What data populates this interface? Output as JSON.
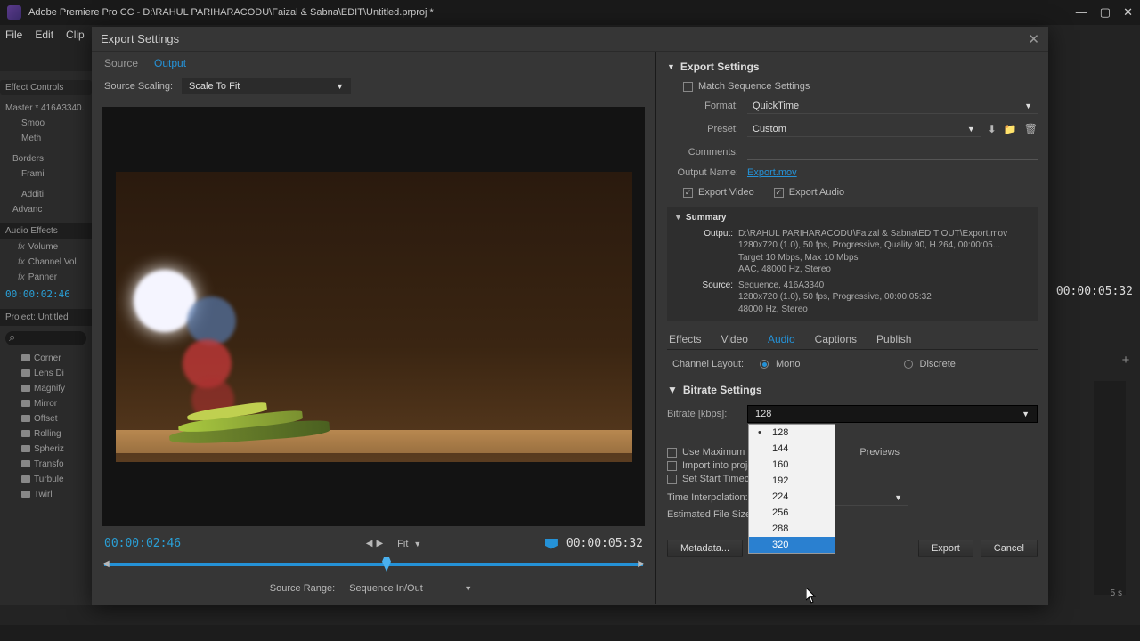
{
  "app_titlebar": "Adobe Premiere Pro CC - D:\\RAHUL PARIHARACODU\\Faizal & Sabna\\EDIT\\Untitled.prproj *",
  "menu": [
    "File",
    "Edit",
    "Clip"
  ],
  "left_panel": {
    "effect_controls": "Effect Controls",
    "master": "Master * 416A3340.",
    "items_top": [
      "Smoo",
      "Meth",
      " ",
      "Borders",
      "Frami",
      " ",
      "Additi",
      "Advanc"
    ],
    "audio_effects": "Audio Effects",
    "audio_fx": [
      "Volume",
      "Channel Vol",
      "Panner"
    ],
    "timecode": "00:00:02:46",
    "project": "Project: Untitled",
    "fx_list": [
      "Corner",
      "Lens Di",
      "Magnify",
      "Mirror",
      "Offset",
      "Rolling",
      "Spheriz",
      "Transfo",
      "Turbule",
      "Twirl"
    ]
  },
  "dialog": {
    "title": "Export Settings",
    "tabs": {
      "source": "Source",
      "output": "Output"
    },
    "scaling_label": "Source Scaling:",
    "scaling_value": "Scale To Fit",
    "tc_left": "00:00:02:46",
    "tc_right": "00:00:05:32",
    "fit_label": "Fit",
    "source_range_label": "Source Range:",
    "source_range_value": "Sequence In/Out"
  },
  "export": {
    "header": "Export Settings",
    "match": "Match Sequence Settings",
    "format_label": "Format:",
    "format_value": "QuickTime",
    "preset_label": "Preset:",
    "preset_value": "Custom",
    "comments_label": "Comments:",
    "outputname_label": "Output Name:",
    "outputname_value": "Export.mov",
    "export_video": "Export Video",
    "export_audio": "Export Audio",
    "summary_label": "Summary",
    "summary": {
      "output_key": "Output:",
      "output_lines": [
        "D:\\RAHUL PARIHARACODU\\Faizal & Sabna\\EDIT OUT\\Export.mov",
        "1280x720 (1.0), 50 fps, Progressive, Quality 90, H.264, 00:00:05...",
        "Target 10 Mbps, Max 10 Mbps",
        "AAC, 48000 Hz, Stereo"
      ],
      "source_key": "Source:",
      "source_lines": [
        "Sequence, 416A3340",
        "1280x720 (1.0), 50 fps, Progressive, 00:00:05:32",
        "48000 Hz, Stereo"
      ]
    },
    "tabs2": [
      "Effects",
      "Video",
      "Audio",
      "Captions",
      "Publish"
    ],
    "channel_label": "Channel Layout:",
    "channel_mono": "Mono",
    "channel_discrete": "Discrete",
    "bitrate_header": "Bitrate Settings",
    "bitrate_label": "Bitrate [kbps]:",
    "bitrate_value": "128",
    "bitrate_options": [
      "128",
      "144",
      "160",
      "192",
      "224",
      "256",
      "288",
      "320"
    ],
    "use_max_render": "Use Maximum Re",
    "previews": "Previews",
    "import_proj": "Import into proje",
    "set_start_tc": "Set Start Timeco",
    "time_interp": "Time Interpolation:",
    "est_size": "Estimated File Size:",
    "metadata_btn": "Metadata...",
    "export_btn": "Export",
    "cancel_btn": "Cancel"
  },
  "right_extra": {
    "tc": "00:00:05:32",
    "scale": "5 s"
  }
}
